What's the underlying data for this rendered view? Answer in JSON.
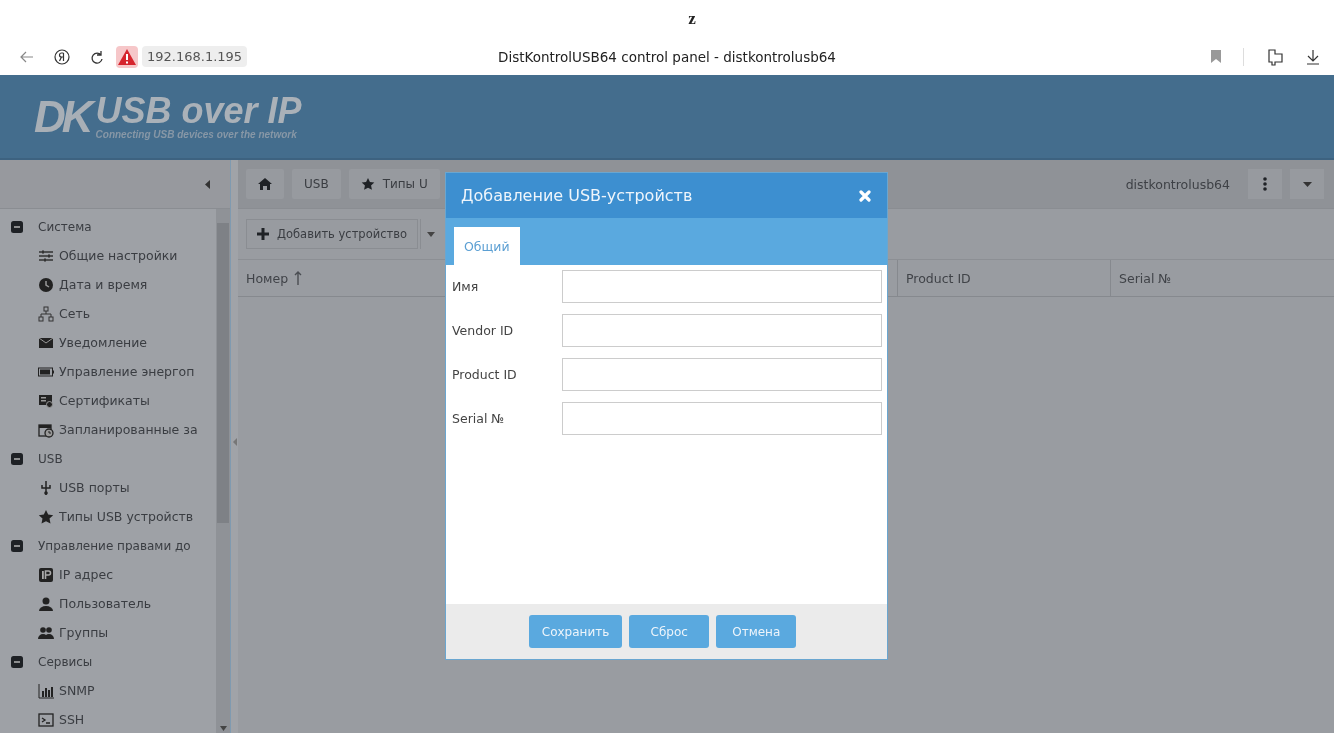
{
  "top_mark": "z",
  "browser": {
    "address": "192.168.1.195",
    "security_warning": true,
    "title": "DistKontrolUSB64 control panel - distkontrolusb64"
  },
  "header": {
    "logo_letters": "DK",
    "product": "USB over IP",
    "tagline": "Connecting USB devices over the network"
  },
  "toolbar": {
    "breadcrumbs": [
      "USB",
      "Типы U"
    ],
    "user": "distkontrolusb64"
  },
  "sidebar": {
    "items": [
      {
        "label": "Система",
        "expanded": true,
        "children": [
          {
            "label": "Общие настройки"
          },
          {
            "label": "Дата и время"
          },
          {
            "label": "Сеть"
          },
          {
            "label": "Уведомление"
          },
          {
            "label": "Управление энергоп"
          },
          {
            "label": "Сертификаты"
          },
          {
            "label": "Запланированные за"
          }
        ]
      },
      {
        "label": "USB",
        "expanded": true,
        "children": [
          {
            "label": "USB порты"
          },
          {
            "label": "Типы USB устройств"
          }
        ]
      },
      {
        "label": "Управление правами до",
        "expanded": true,
        "children": [
          {
            "label": "IP адрес"
          },
          {
            "label": "Пользователь"
          },
          {
            "label": "Группы"
          }
        ]
      },
      {
        "label": "Сервисы",
        "expanded": true,
        "children": [
          {
            "label": "SNMP"
          },
          {
            "label": "SSH"
          }
        ]
      }
    ]
  },
  "content": {
    "add_button": "Добавить устройство",
    "columns": [
      {
        "label": "Номер",
        "sorted": true
      },
      {
        "label": "Product ID",
        "sorted": false
      },
      {
        "label": "Serial №",
        "sorted": false
      }
    ]
  },
  "modal": {
    "title": "Добавление USB-устройств",
    "tabs": [
      {
        "label": "Общий",
        "selected": true
      }
    ],
    "fields": [
      {
        "label": "Имя"
      },
      {
        "label": "Vendor ID"
      },
      {
        "label": "Product ID"
      },
      {
        "label": "Serial №"
      }
    ],
    "buttons": [
      "Сохранить",
      "Сброс",
      "Отмена"
    ]
  }
}
